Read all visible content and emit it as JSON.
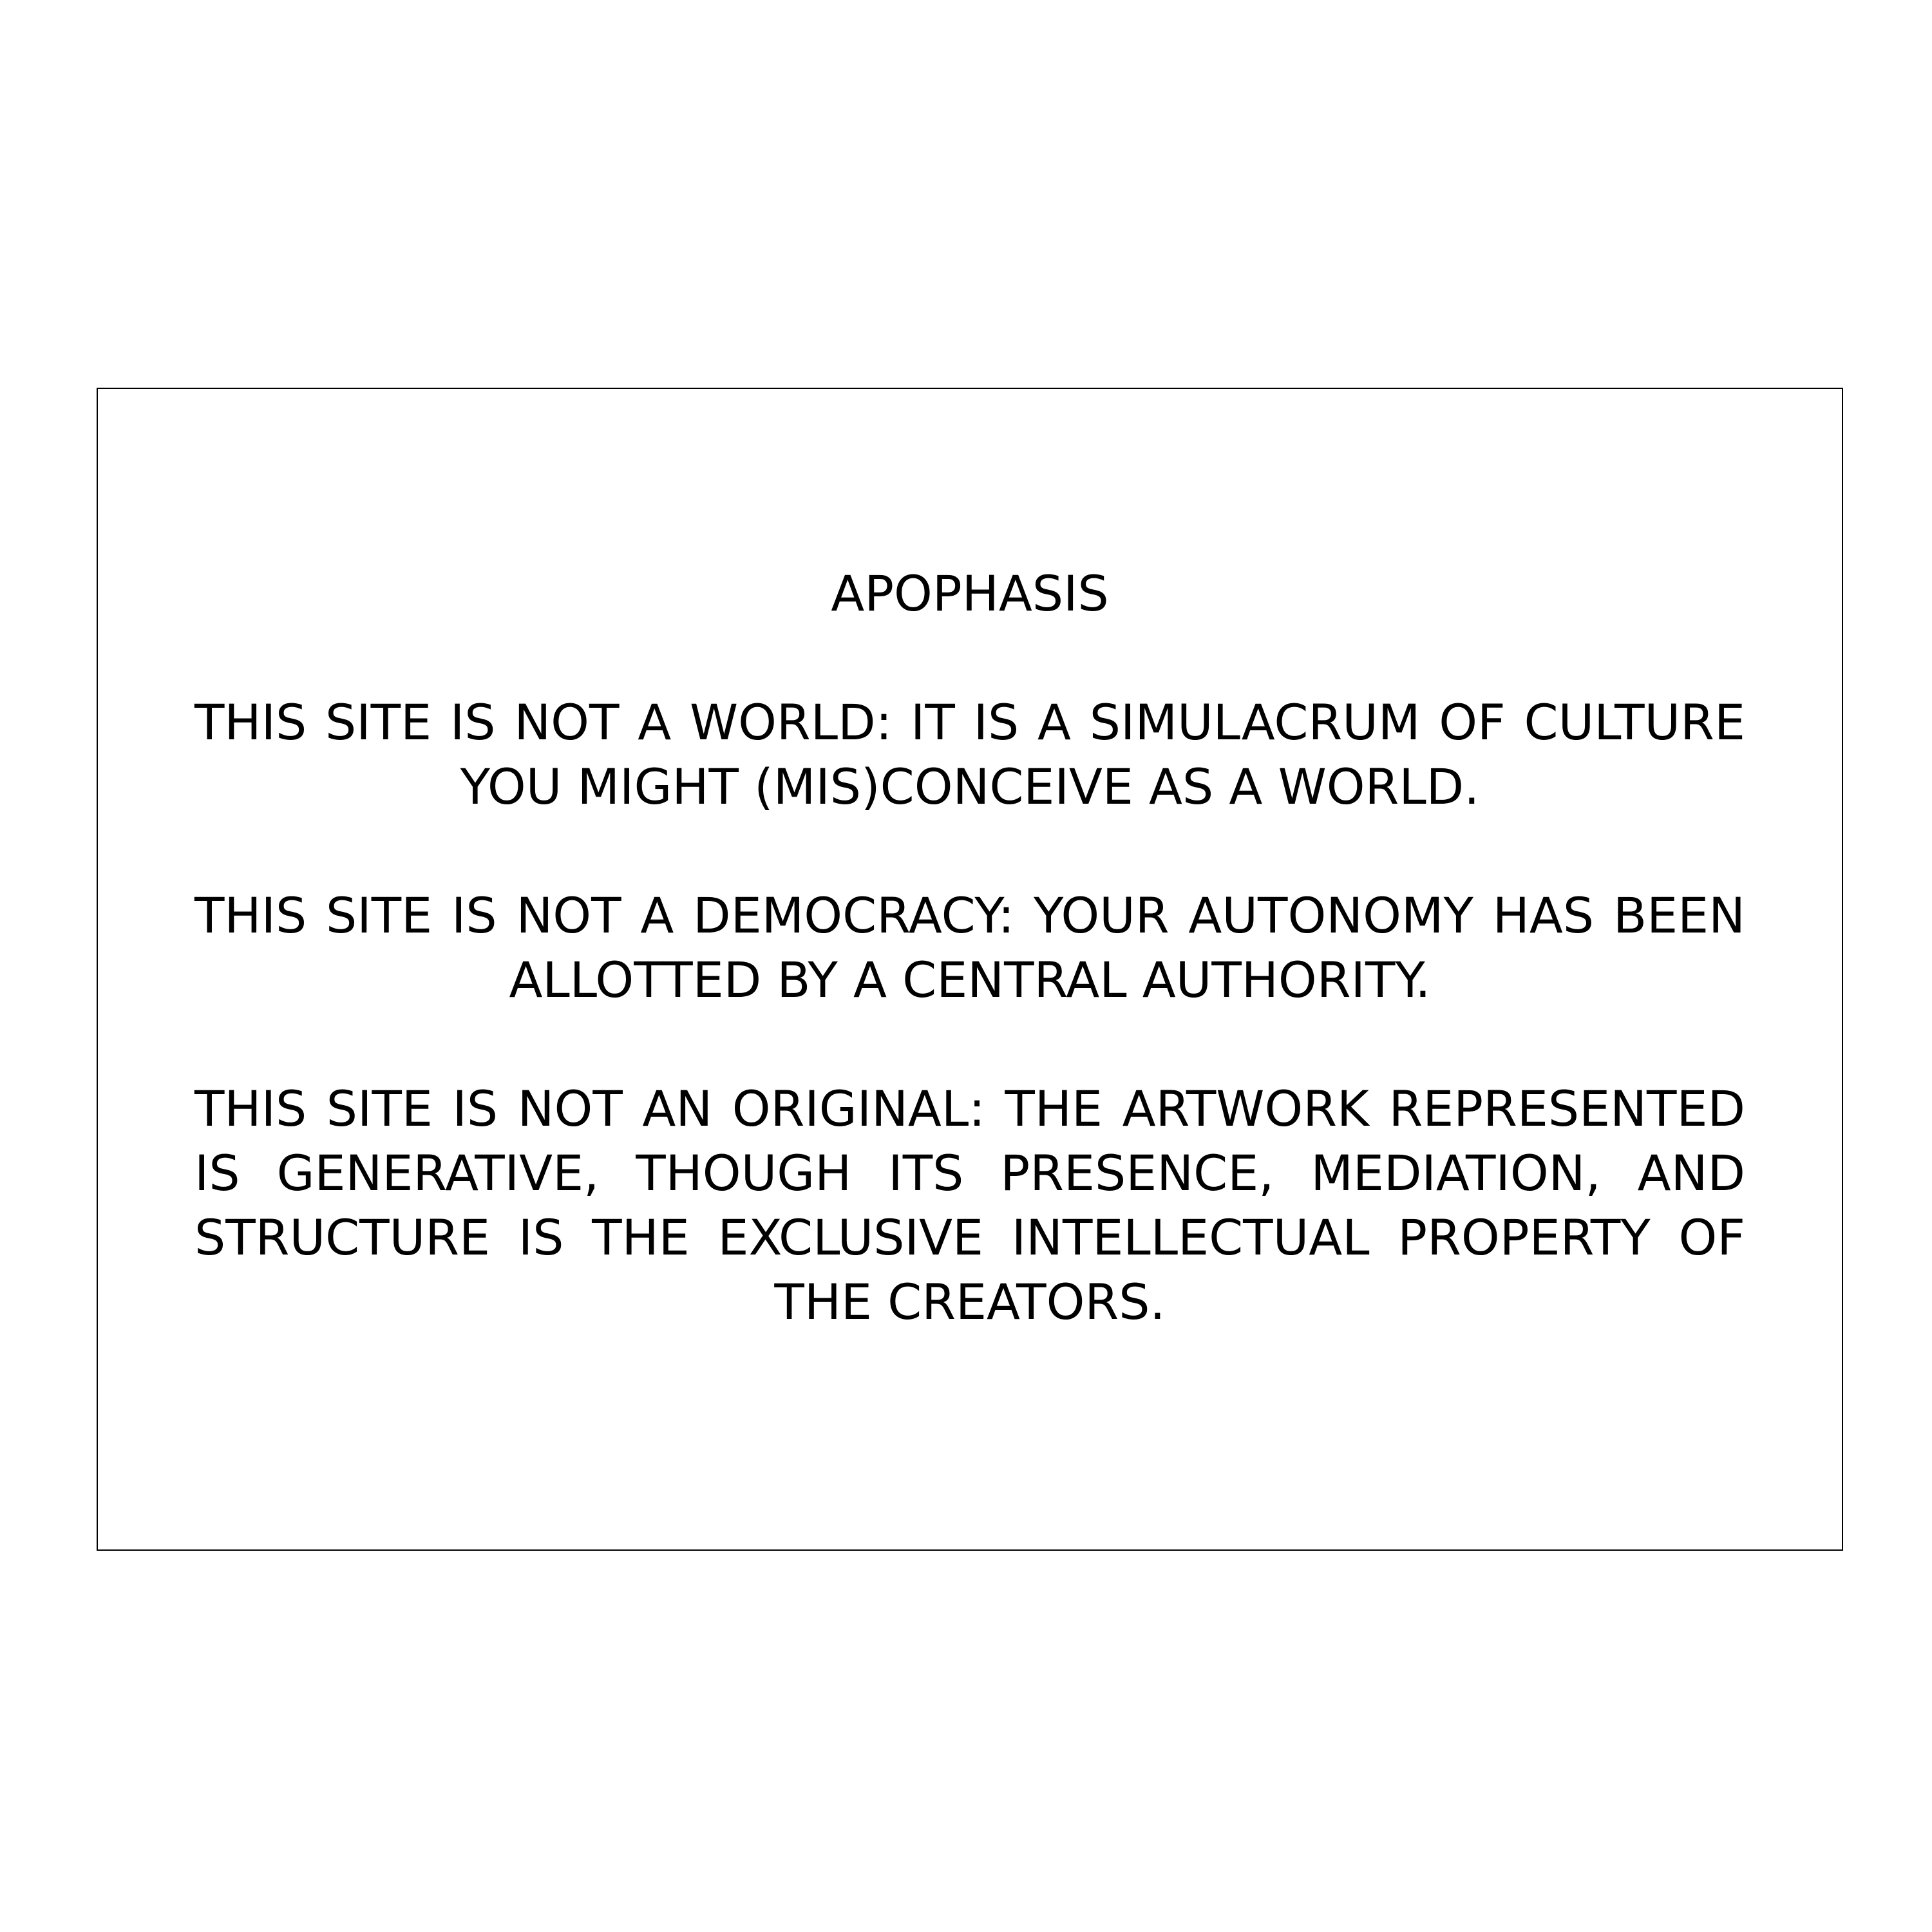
{
  "notice": {
    "title": "APOPHASIS",
    "paragraphs": [
      "THIS SITE IS NOT A WORLD: IT IS A SIMULACRUM OF CULTURE YOU MIGHT (MIS)CONCEIVE AS A WORLD.",
      "THIS SITE IS NOT A DEMOCRACY: YOUR AUTONOMY HAS BEEN ALLOTTED BY A CENTRAL AUTHORITY.",
      "THIS SITE IS NOT AN ORIGINAL: THE ARTWORK REPRESENTED IS GENERATIVE, THOUGH ITS PRESENCE, MEDIATION, AND STRUCTURE IS THE EXCLUSIVE INTELLECTUAL PROPERTY OF THE CREATORS."
    ]
  },
  "colors": {
    "background": "#ffffff",
    "text": "#000000",
    "border": "#000000"
  }
}
